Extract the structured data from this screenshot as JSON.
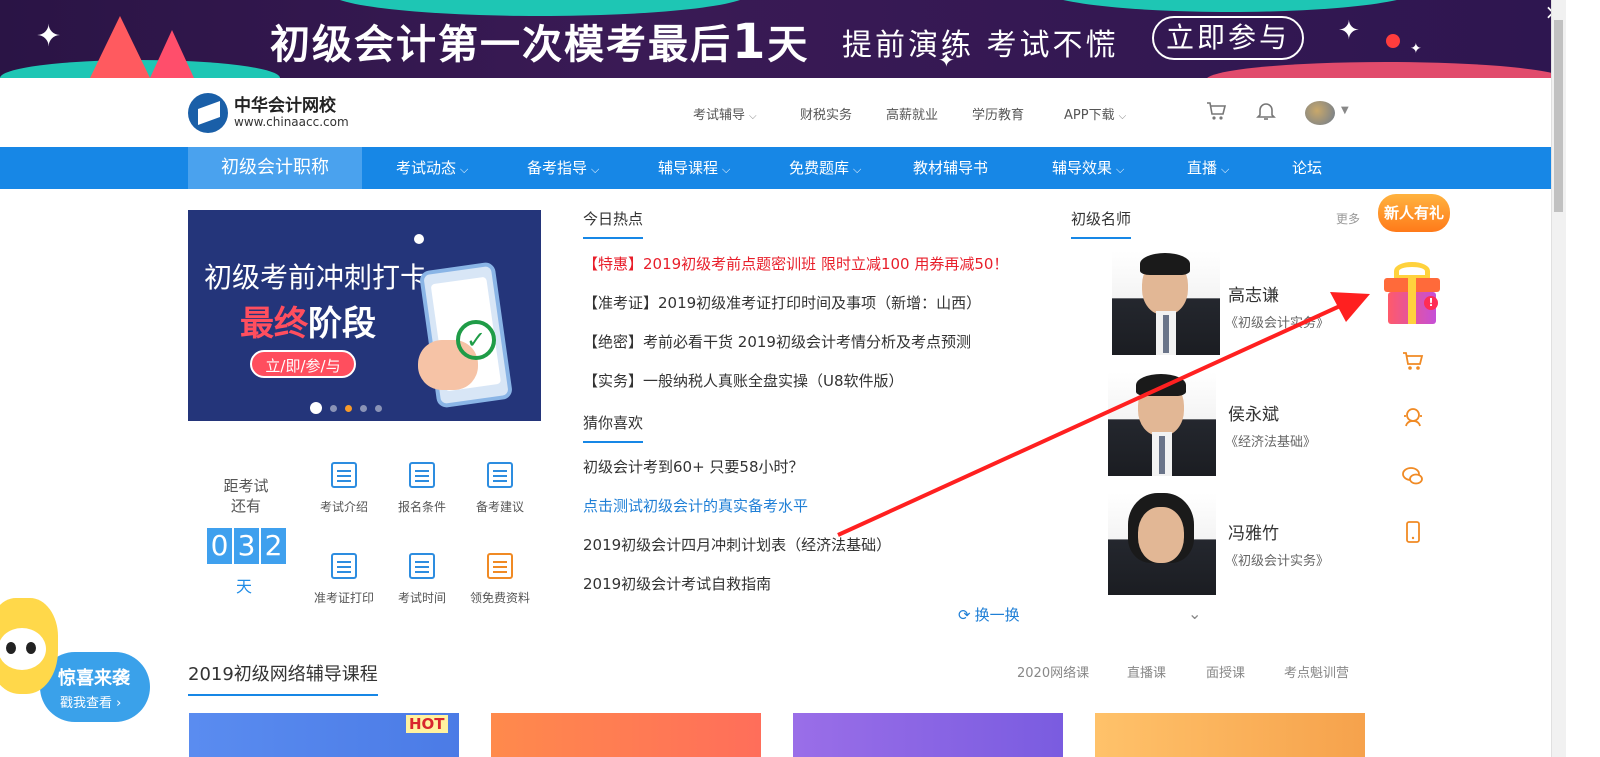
{
  "banner": {
    "title_a": "初级会计第一次模考最后",
    "title_num": "1",
    "title_b": "天",
    "subtitle": "提前演练 考试不慌",
    "cta": "立即参与",
    "close": "×"
  },
  "header": {
    "logo_cn": "中华会计网校",
    "logo_en": "www.chinaacc.com",
    "links": [
      "考试辅导",
      "财税实务",
      "高薪就业",
      "学历教育",
      "APP下载"
    ]
  },
  "mainnav": {
    "home": "初级会计职称",
    "items": [
      "考试动态",
      "备考指导",
      "辅导课程",
      "免费题库",
      "教材辅导书",
      "辅导效果",
      "直播",
      "论坛"
    ]
  },
  "hero": {
    "line1": "初级考前冲刺打卡",
    "line2_red": "最终",
    "line2_white": "阶段",
    "button": "立/即/参/与"
  },
  "countdown": {
    "label1": "距考试",
    "label2": "还有",
    "digits": [
      "0",
      "3",
      "2"
    ],
    "unit": "天"
  },
  "tools": [
    "考试介绍",
    "报名条件",
    "备考建议",
    "准考证打印",
    "考试时间",
    "领免费资料"
  ],
  "hot": {
    "title": "今日热点",
    "items": [
      "【特惠】2019初级考前点题密训班 限时立减100 用券再减50！",
      "【准考证】2019初级准考证打印时间及事项（新增：山西）",
      "【绝密】考前必看干货 2019初级会计考情分析及考点预测",
      "【实务】一般纳税人真账全盘实操（U8软件版）"
    ]
  },
  "guess": {
    "title": "猜你喜欢",
    "items": [
      "初级会计考到60+ 只要58小时？",
      "点击测试初级会计的真实备考水平",
      "2019初级会计四月冲刺计划表（经济法基础）",
      "2019初级会计考试自救指南"
    ],
    "refresh": "换一换"
  },
  "teachers": {
    "title": "初级名师",
    "more": "更多",
    "list": [
      {
        "name": "高志谦",
        "book": "《初级会计实务》"
      },
      {
        "name": "侯永斌",
        "book": "《经济法基础》"
      },
      {
        "name": "冯雅竹",
        "book": "《初级会计实务》"
      }
    ]
  },
  "sidebar": {
    "new_gift": "新人有礼"
  },
  "courses": {
    "title": "2019初级网络辅导课程",
    "tabs": [
      "2020网络课",
      "直播课",
      "面授课",
      "考点魁训营"
    ],
    "hot_badge": "HOT"
  },
  "mascot": {
    "line1": "惊喜来袭",
    "line2": "戳我查看 ›"
  },
  "colors": {
    "nav_blue": "#1787e6",
    "accent_orange": "#f08a24",
    "news_red": "#e81e2a",
    "link_blue": "#1f7fd6",
    "arrow_red": "#ff2020"
  }
}
